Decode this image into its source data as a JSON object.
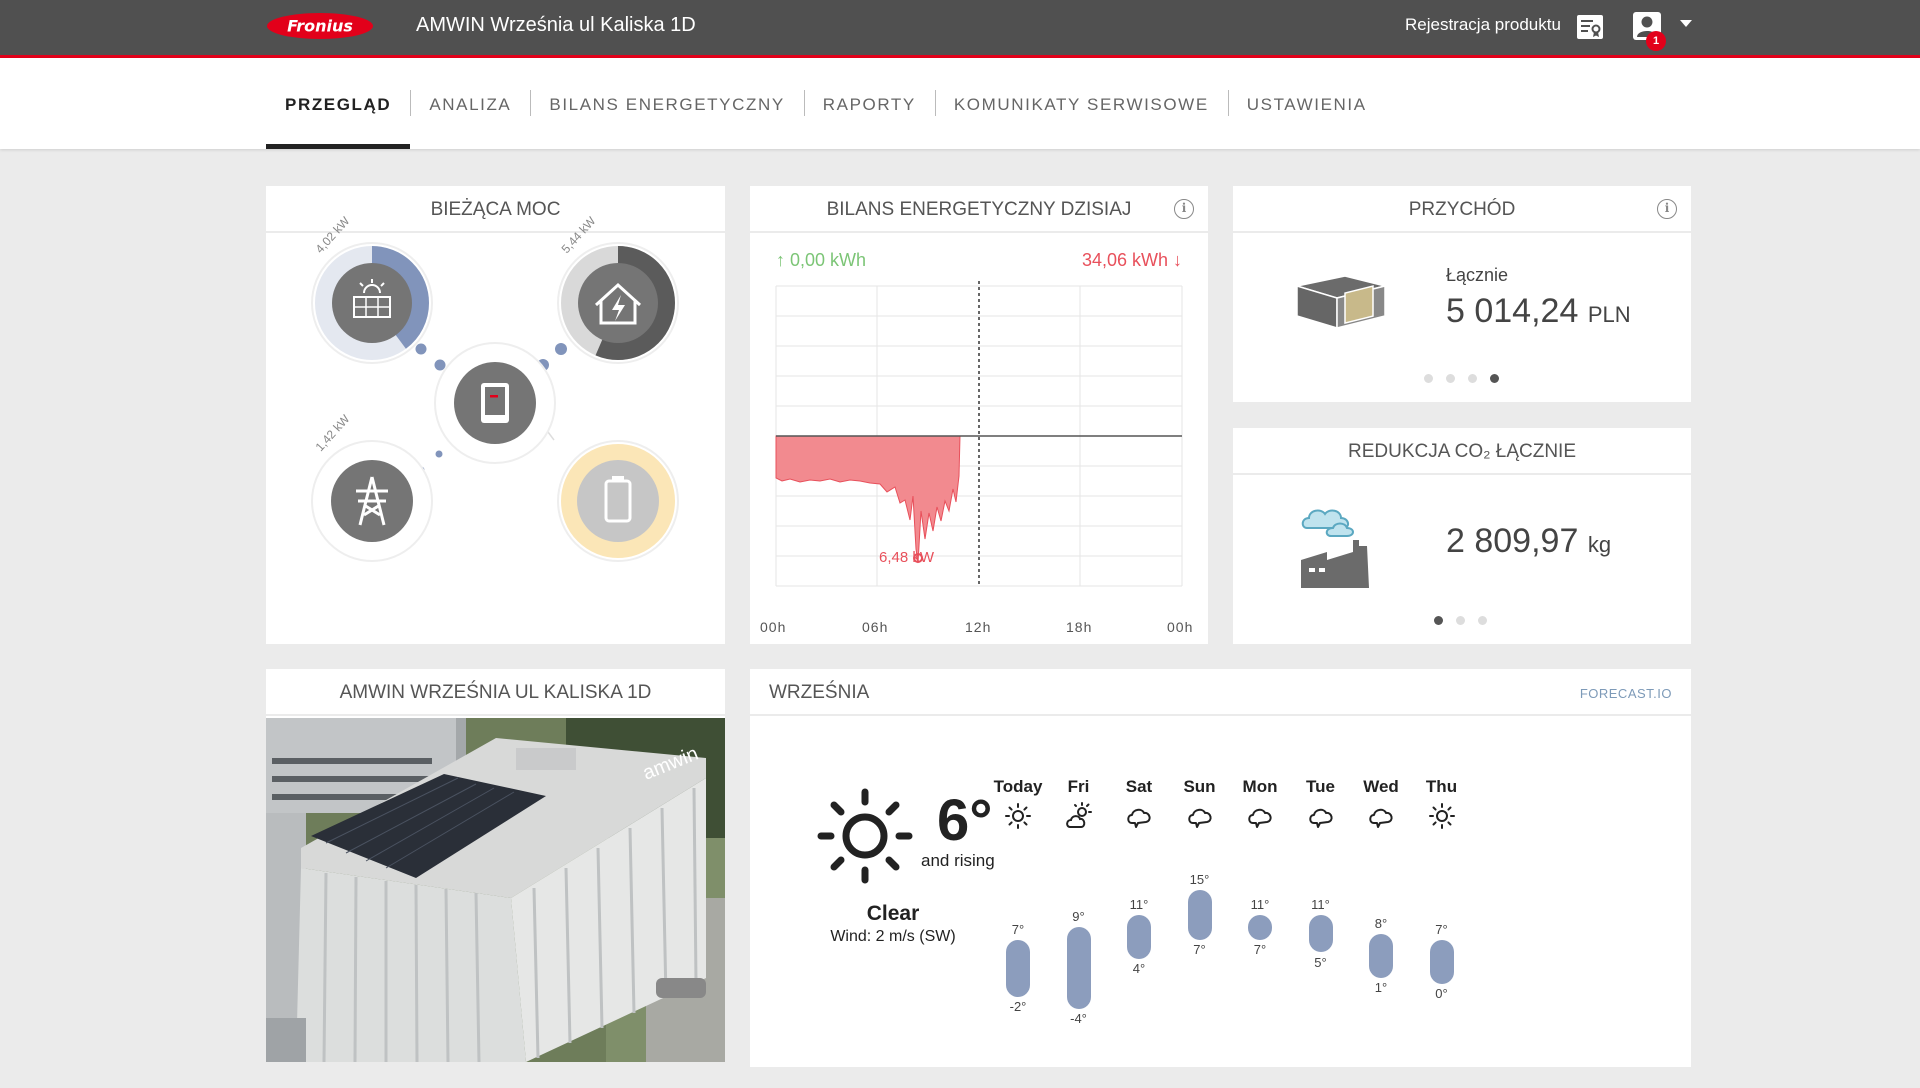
{
  "header": {
    "logo_text": "Fronius",
    "site_title": "AMWIN Września ul Kaliska 1D",
    "register_label": "Rejestracja produktu",
    "notification_count": "1",
    "brand_color": "#e2001a"
  },
  "nav": {
    "items": [
      "PRZEGLĄD",
      "ANALIZA",
      "BILANS ENERGETYCZNY",
      "RAPORTY",
      "KOMUNIKATY SERWISOWE",
      "USTAWIENIA"
    ],
    "active": "PRZEGLĄD"
  },
  "current_power": {
    "title": "BIEŻĄCA MOC",
    "pv_label": "4,02 kW",
    "load_label": "5,44 kW",
    "grid_label": "1,42 kW",
    "icons": [
      "solar-panel-icon",
      "house-load-icon",
      "inverter-icon",
      "grid-tower-icon",
      "battery-icon"
    ]
  },
  "energy_balance": {
    "title": "BILANS ENERGETYCZNY DZISIAJ",
    "produced": "↑ 0,00 kWh",
    "consumed": "34,06 kWh ↓",
    "peak_label": "6,48 kW",
    "x_ticks": [
      "00h",
      "06h",
      "12h",
      "18h",
      "00h"
    ],
    "consumed_color": "#e8505b",
    "produced_color": "#7cc576"
  },
  "revenue": {
    "title": "PRZYCHÓD",
    "label": "Łącznie",
    "value": "5 014,24",
    "unit": "PLN",
    "pages": 4,
    "active_page": 4
  },
  "co2": {
    "title": "REDUKCJA CO₂ ŁĄCZNIE",
    "value": "2 809,97",
    "unit": "kg",
    "pages": 3,
    "active_page": 1
  },
  "site_photo": {
    "title": "AMWIN WRZEŚNIA UL KALISKA 1D",
    "sign_text": "amwin"
  },
  "weather": {
    "city": "WRZEŚNIA",
    "source": "FORECAST.IO",
    "current_temp": "6°",
    "trend": "and rising",
    "condition": "Clear",
    "wind": "Wind: 2 m/s (SW)",
    "days": [
      {
        "name": "Today",
        "icon": "sun-icon",
        "high": "7°",
        "low": "-2°"
      },
      {
        "name": "Fri",
        "icon": "partly-cloudy-icon",
        "high": "9°",
        "low": "-4°"
      },
      {
        "name": "Sat",
        "icon": "cloud-icon",
        "high": "11°",
        "low": "4°"
      },
      {
        "name": "Sun",
        "icon": "cloud-icon",
        "high": "15°",
        "low": "7°"
      },
      {
        "name": "Mon",
        "icon": "cloud-icon",
        "high": "11°",
        "low": "7°"
      },
      {
        "name": "Tue",
        "icon": "cloud-icon",
        "high": "11°",
        "low": "5°"
      },
      {
        "name": "Wed",
        "icon": "cloud-icon",
        "high": "8°",
        "low": "1°"
      },
      {
        "name": "Thu",
        "icon": "sun-icon",
        "high": "7°",
        "low": "0°"
      }
    ]
  }
}
